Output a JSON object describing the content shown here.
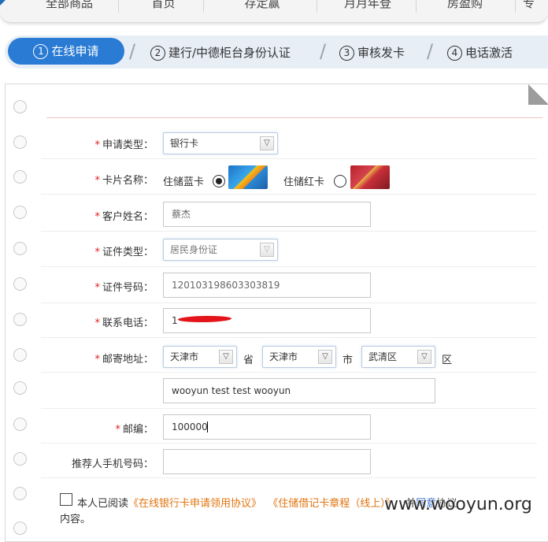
{
  "topnav": {
    "items": [
      "全部商品",
      "首页",
      "存定赢",
      "月月年登",
      "房盈购",
      "专"
    ]
  },
  "steps": [
    {
      "num": "1",
      "label": "在线申请"
    },
    {
      "num": "2",
      "label": "建行/中德柜台身份认证"
    },
    {
      "num": "3",
      "label": "审核发卡"
    },
    {
      "num": "4",
      "label": "电话激活"
    }
  ],
  "form": {
    "apply_type": {
      "label": "申请类型：",
      "value": "银行卡"
    },
    "card_name": {
      "label": "卡片名称：",
      "options": [
        {
          "label": "住储蓝卡",
          "selected": true
        },
        {
          "label": "住储红卡",
          "selected": false
        }
      ]
    },
    "customer_name": {
      "label": "客户姓名：",
      "value": "蔡杰"
    },
    "id_type": {
      "label": "证件类型：",
      "value": "居民身份证"
    },
    "id_number": {
      "label": "证件号码：",
      "value": "120103198603303819"
    },
    "phone": {
      "label": "联系电话：",
      "value": "1"
    },
    "address": {
      "label": "邮寄地址：",
      "province": "天津市",
      "province_unit": "省",
      "city": "天津市",
      "city_unit": "市",
      "district": "武清区",
      "district_unit": "区",
      "detail": "wooyun test  test wooyun"
    },
    "postcode": {
      "label": "邮编：",
      "value": "100000"
    },
    "referrer": {
      "label": "推荐人手机号码：",
      "value": ""
    }
  },
  "agreement": {
    "prefix": "本人已阅读",
    "link1": "《在线银行卡申请领用协议》",
    "link2": "《住储借记卡章程（线上）》",
    "mid": "并",
    "link3": "同意",
    "suffix": "协议",
    "line2": "内容。"
  },
  "watermark": "www.wooyun.org",
  "colors": {
    "accent": "#2a7bd3",
    "required": "#e02020",
    "link_orange": "#e2740f"
  }
}
